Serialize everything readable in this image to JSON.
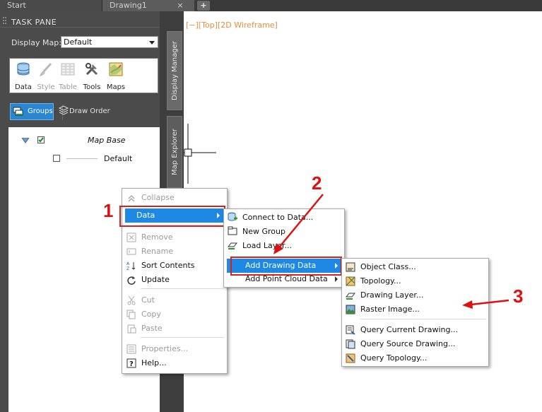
{
  "tabs": {
    "start": "Start",
    "drawing": "Drawing1",
    "close": "×",
    "add": "+"
  },
  "task_pane": {
    "title": "TASK PANE",
    "display_map_label": "Display Map:",
    "display_map_value": "Default",
    "ribbon": {
      "data": "Data",
      "style": "Style",
      "table": "Table",
      "tools": "Tools",
      "maps": "Maps"
    },
    "groups_label": "Groups",
    "draw_order_label": "Draw Order",
    "tree": {
      "group": "Map Base",
      "layer": "Default"
    }
  },
  "side_tabs": {
    "display_manager": "Display Manager",
    "map_explorer": "Map Explorer"
  },
  "viewport_label": "[−][Top][2D Wireframe]",
  "menu1": {
    "collapse": "Collapse",
    "data": "Data",
    "remove": "Remove",
    "rename": "Rename",
    "sort": "Sort Contents",
    "update": "Update",
    "cut": "Cut",
    "copy": "Copy",
    "paste": "Paste",
    "properties": "Properties...",
    "help": "Help..."
  },
  "menu2": {
    "connect": "Connect to Data...",
    "new_group": "New Group",
    "load_layer": "Load Layer...",
    "add_drawing": "Add Drawing Data",
    "add_point_cloud": "Add Point Cloud Data"
  },
  "menu3": {
    "object_class": "Object Class...",
    "topology": "Topology...",
    "drawing_layer": "Drawing Layer...",
    "raster_image": "Raster Image...",
    "query_current": "Query Current Drawing...",
    "query_source": "Query Source Drawing...",
    "query_topology": "Query Topology..."
  },
  "callouts": {
    "c1": "1",
    "c2": "2",
    "c3": "3"
  },
  "colors": {
    "accent": "#1e88e5",
    "callout": "#d32020",
    "viewport_label": "#ef8a3c"
  }
}
